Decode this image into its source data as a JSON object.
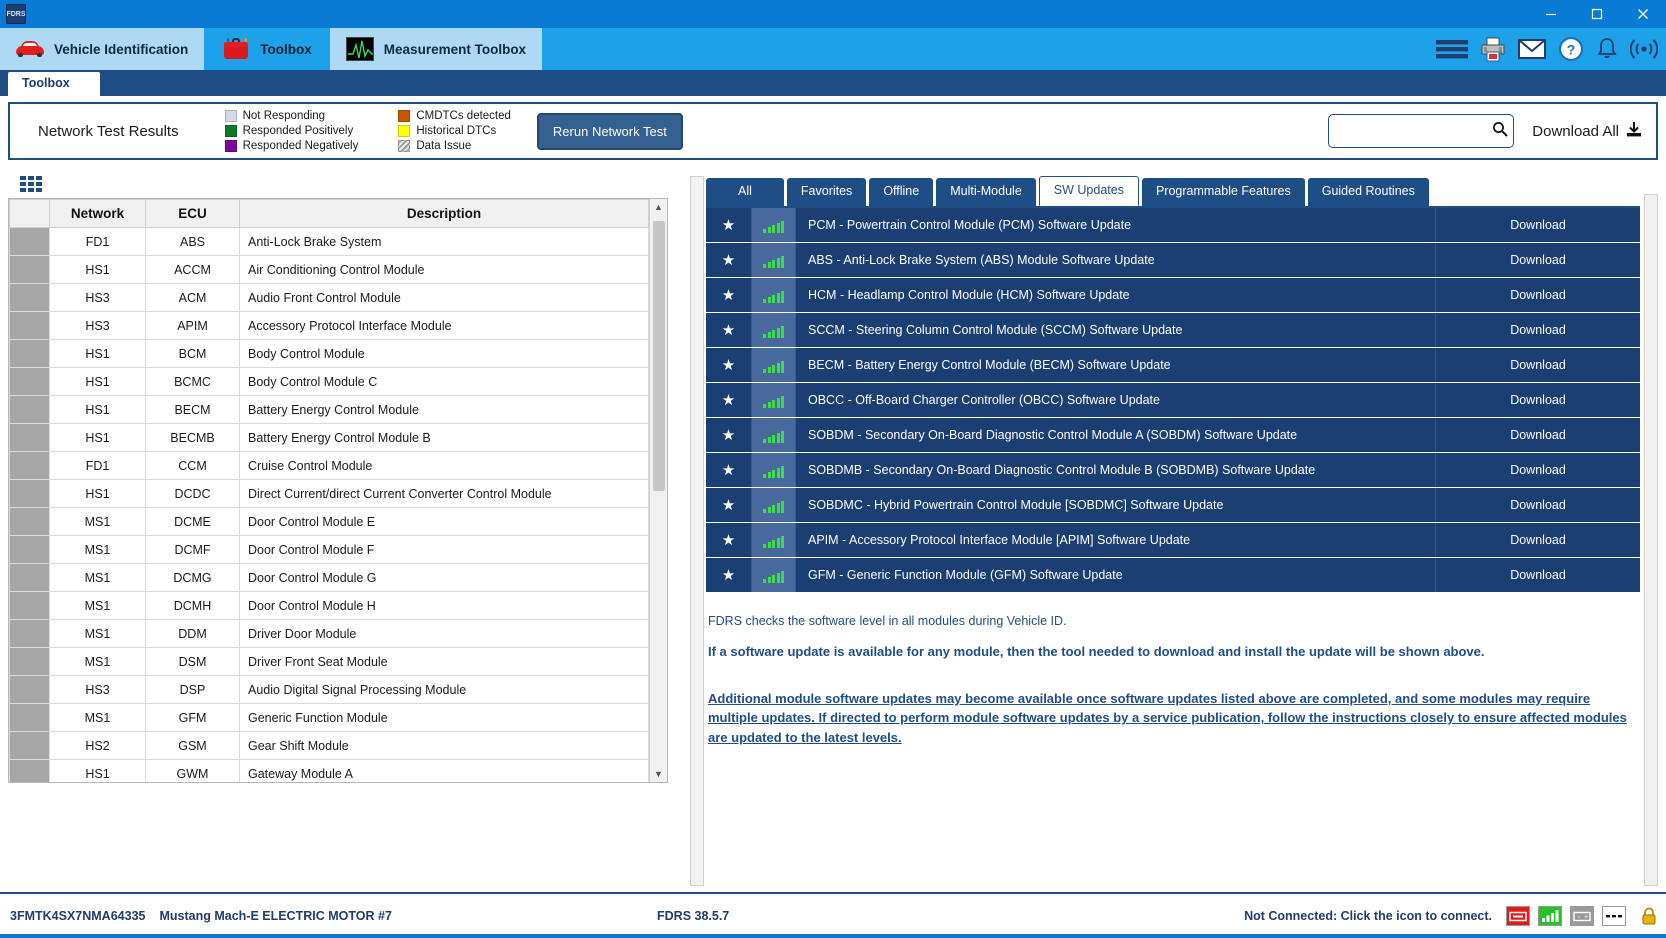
{
  "window": {
    "minimize_label": "minimize-icon",
    "maximize_label": "maximize-icon",
    "close_label": "close-icon"
  },
  "module_tabs": [
    {
      "label": "Vehicle Identification",
      "icon": "car-icon",
      "active": false
    },
    {
      "label": "Toolbox",
      "icon": "toolbox-icon",
      "active": true
    },
    {
      "label": "Measurement Toolbox",
      "icon": "oscilloscope-icon",
      "active": false
    }
  ],
  "header_icons": [
    "menu-icon",
    "printer-icon",
    "mail-icon",
    "help-icon",
    "bell-icon",
    "broadcast-icon"
  ],
  "sub_tab": {
    "label": "Toolbox"
  },
  "results": {
    "title": "Network Test Results",
    "legend_left": [
      {
        "label": "Not Responding",
        "color": "#d9d9e2",
        "style": "grey"
      },
      {
        "label": "Responded Positively",
        "color": "#0d7b26",
        "style": "green"
      },
      {
        "label": "Responded Negatively",
        "color": "#7a0a9e",
        "style": "purple"
      }
    ],
    "legend_right": [
      {
        "label": "CMDTCs detected",
        "color": "#cc5500",
        "style": "orange"
      },
      {
        "label": "Historical DTCs",
        "color": "#ffff00",
        "style": "yellow"
      },
      {
        "label": "Data Issue",
        "color": "#9a9a9a",
        "style": "hatch"
      }
    ],
    "rerun_button": "Rerun Network Test",
    "search_value": "",
    "search_placeholder": "",
    "search_icon": "search-icon",
    "download_all": "Download All",
    "download_all_icon": "download-icon"
  },
  "network_table": {
    "columns": [
      "",
      "Network",
      "ECU",
      "Description"
    ],
    "rows": [
      {
        "network": "FD1",
        "ecu": "ABS",
        "description": "Anti-Lock Brake System"
      },
      {
        "network": "HS1",
        "ecu": "ACCM",
        "description": "Air Conditioning Control Module"
      },
      {
        "network": "HS3",
        "ecu": "ACM",
        "description": "Audio Front Control Module"
      },
      {
        "network": "HS3",
        "ecu": "APIM",
        "description": "Accessory Protocol Interface Module"
      },
      {
        "network": "HS1",
        "ecu": "BCM",
        "description": "Body Control Module"
      },
      {
        "network": "HS1",
        "ecu": "BCMC",
        "description": "Body Control Module C"
      },
      {
        "network": "HS1",
        "ecu": "BECM",
        "description": "Battery Energy Control Module"
      },
      {
        "network": "HS1",
        "ecu": "BECMB",
        "description": "Battery Energy Control Module B"
      },
      {
        "network": "FD1",
        "ecu": "CCM",
        "description": "Cruise Control Module"
      },
      {
        "network": "HS1",
        "ecu": "DCDC",
        "description": "Direct Current/direct Current Converter Control Module"
      },
      {
        "network": "MS1",
        "ecu": "DCME",
        "description": "Door Control Module E"
      },
      {
        "network": "MS1",
        "ecu": "DCMF",
        "description": "Door Control Module F"
      },
      {
        "network": "MS1",
        "ecu": "DCMG",
        "description": "Door Control Module G"
      },
      {
        "network": "MS1",
        "ecu": "DCMH",
        "description": "Door Control Module H"
      },
      {
        "network": "MS1",
        "ecu": "DDM",
        "description": "Driver Door Module"
      },
      {
        "network": "MS1",
        "ecu": "DSM",
        "description": "Driver Front Seat Module"
      },
      {
        "network": "HS3",
        "ecu": "DSP",
        "description": "Audio Digital Signal Processing Module"
      },
      {
        "network": "MS1",
        "ecu": "GFM",
        "description": "Generic Function Module"
      },
      {
        "network": "HS2",
        "ecu": "GSM",
        "description": "Gear Shift Module"
      },
      {
        "network": "HS1",
        "ecu": "GWM",
        "description": "Gateway Module A"
      }
    ]
  },
  "right_tabs": [
    {
      "label": "All",
      "active": false
    },
    {
      "label": "Favorites",
      "active": false
    },
    {
      "label": "Offline",
      "active": false
    },
    {
      "label": "Multi-Module",
      "active": false
    },
    {
      "label": "SW Updates",
      "active": true
    },
    {
      "label": "Programmable Features",
      "active": false
    },
    {
      "label": "Guided Routines",
      "active": false
    }
  ],
  "updates": {
    "star_icon": "star-icon",
    "signal_icon": "signal-bars-icon",
    "action_label": "Download",
    "rows": [
      {
        "description": "PCM - Powertrain Control Module (PCM) Software Update"
      },
      {
        "description": "ABS - Anti-Lock Brake System (ABS) Module Software Update"
      },
      {
        "description": "HCM - Headlamp Control Module (HCM) Software Update"
      },
      {
        "description": "SCCM - Steering Column Control Module (SCCM) Software Update"
      },
      {
        "description": "BECM - Battery Energy Control Module (BECM) Software Update"
      },
      {
        "description": "OBCC - Off-Board Charger Controller (OBCC) Software Update"
      },
      {
        "description": "SOBDM - Secondary On-Board Diagnostic Control Module A (SOBDM) Software Update"
      },
      {
        "description": "SOBDMB - Secondary On-Board Diagnostic Control Module B (SOBDMB) Software Update"
      },
      {
        "description": "SOBDMC - Hybrid Powertrain Control Module [SOBDMC] Software Update"
      },
      {
        "description": "APIM - Accessory Protocol Interface Module [APIM] Software Update"
      },
      {
        "description": "GFM - Generic Function Module (GFM) Software Update"
      }
    ]
  },
  "notes": {
    "line1": "FDRS checks the software level in all modules during Vehicle ID.",
    "line2": "If a software update is available for any module, then the tool needed to download and install the update will be shown above.",
    "line3": "Additional module software updates may become available once software updates listed above are completed, and some modules may require multiple updates. If directed to perform module software updates by a service publication, follow the instructions closely to ensure affected modules are updated to the latest levels."
  },
  "status_bar": {
    "vin": "3FMTK4SX7NMA64335",
    "vehicle": "Mustang Mach-E ELECTRIC MOTOR #7",
    "version": "FDRS 38.5.7",
    "connection_message": "Not Connected: Click the icon to connect.",
    "icons": [
      "vcm-icon",
      "signal-icon",
      "battery-icon",
      "dashes-icon",
      "lock-icon"
    ]
  }
}
